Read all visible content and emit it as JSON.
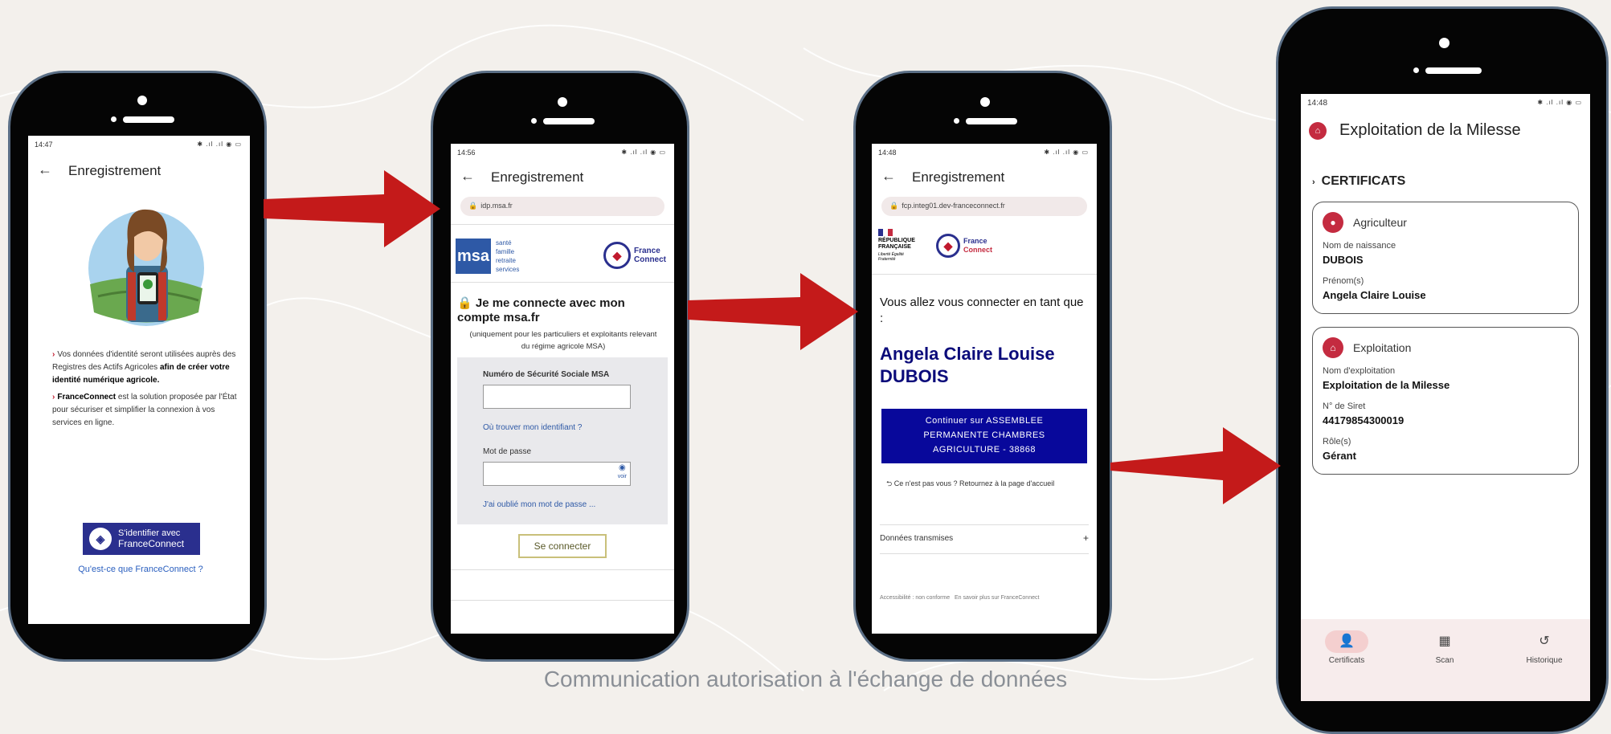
{
  "caption": "Communication autorisation à l'échange de données",
  "screen1": {
    "time": "14:47",
    "status_right": "✱ .ıl .ıl ◉ ▭",
    "title": "Enregistrement",
    "para1_pre": "Vos données d'identité seront utilisées auprès des Registres des Actifs Agricoles",
    "para1_bold": "afin de créer votre identité numérique agricole.",
    "para2_bold": "FranceConnect",
    "para2_rest": "est la solution proposée par l'État pour sécuriser et simplifier la connexion à vos services en ligne.",
    "fc_button_line1": "S'identifier avec",
    "fc_button_line2": "FranceConnect",
    "fc_link": "Qu'est-ce que FranceConnect ?"
  },
  "screen2": {
    "time": "14:56",
    "status_right": "✱ .ıl .ıl ◉ ▭",
    "title": "Enregistrement",
    "url": "idp.msa.fr",
    "msa_letters": "msa",
    "msa_words": [
      "santé",
      "famille",
      "retraite",
      "services"
    ],
    "fc_word1": "France",
    "fc_word2": "Connect",
    "heading": "Je me connecte avec mon compte msa.fr",
    "subheading": "(uniquement pour les particuliers et exploitants relevant du régime agricole MSA)",
    "ssn_label": "Numéro de Sécurité Sociale MSA",
    "find_id_link": "Où trouver mon identifiant ?",
    "password_label": "Mot de passe",
    "eye_label": "voir",
    "forgot_link": "J'ai oublié mon mot de passe ...",
    "submit": "Se connecter"
  },
  "screen3": {
    "time": "14:48",
    "status_right": "✱ .ıl .ıl ◉ ▭",
    "title": "Enregistrement",
    "url": "fcp.integ01.dev-franceconnect.fr",
    "republique": [
      "RÉPUBLIQUE",
      "FRANÇAISE"
    ],
    "devise": "Liberté Égalité Fraternité",
    "fc_word1": "France",
    "fc_word2": "Connect",
    "intro": "Vous allez vous connecter en tant que :",
    "name_line1": "Angela Claire Louise",
    "name_line2": "DUBOIS",
    "continue_button": "Continuer sur ASSEMBLEE PERMANENTE CHAMBRES AGRICULTURE - 38868",
    "not_you": "Ce n'est pas vous ? Retournez à la page d'accueil",
    "data_sent": "Données transmises",
    "plus": "+",
    "footer": "Accessibilité : non conforme   En savoir plus sur FranceConnect"
  },
  "screen4": {
    "time": "14:48",
    "status_right": "✱ .ıl .ıl ◉ ▭",
    "title": "Exploitation de la Milesse",
    "section": "CERTIFICATS",
    "card1": {
      "name": "Agriculteur",
      "label1": "Nom de naissance",
      "value1": "DUBOIS",
      "label2": "Prénom(s)",
      "value2": "Angela Claire Louise"
    },
    "card2": {
      "name": "Exploitation",
      "label1": "Nom d'exploitation",
      "value1": "Exploitation de la Milesse",
      "label2": "N° de Siret",
      "value2": "44179854300019",
      "label3": "Rôle(s)",
      "value3": "Gérant"
    },
    "nav": [
      "Certificats",
      "Scan",
      "Historique"
    ]
  },
  "colors": {
    "arrow": "#c41a1a",
    "france_connect_blue": "#2a2f8e",
    "continue_blue": "#08089b",
    "accent_red": "#c42b40"
  }
}
